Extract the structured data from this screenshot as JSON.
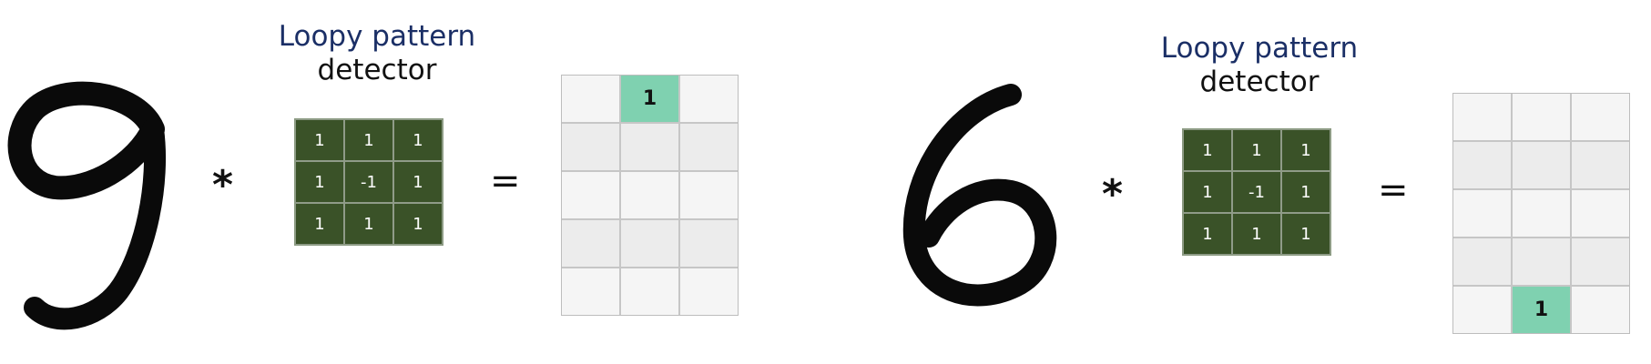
{
  "colors": {
    "title_accent": "#1b2f66",
    "kernel_fill": "#3a5228",
    "output_hit": "#7fd1b0",
    "output_cell": "#f5f5f5"
  },
  "panels": [
    {
      "digit": "9",
      "operator": "*",
      "equals": "=",
      "title_line1": "Loopy pattern",
      "title_line2": "detector",
      "kernel": [
        "1",
        "1",
        "1",
        "1",
        "-1",
        "1",
        "1",
        "1",
        "1"
      ],
      "output": [
        "",
        "1",
        "",
        "",
        "",
        "",
        "",
        "",
        "",
        "",
        "",
        "",
        "",
        "",
        ""
      ]
    },
    {
      "digit": "6",
      "operator": "*",
      "equals": "=",
      "title_line1": "Loopy pattern",
      "title_line2": "detector",
      "kernel": [
        "1",
        "1",
        "1",
        "1",
        "-1",
        "1",
        "1",
        "1",
        "1"
      ],
      "output": [
        "",
        "",
        "",
        "",
        "",
        "",
        "",
        "",
        "",
        "",
        "",
        "",
        "",
        "1",
        ""
      ]
    }
  ]
}
